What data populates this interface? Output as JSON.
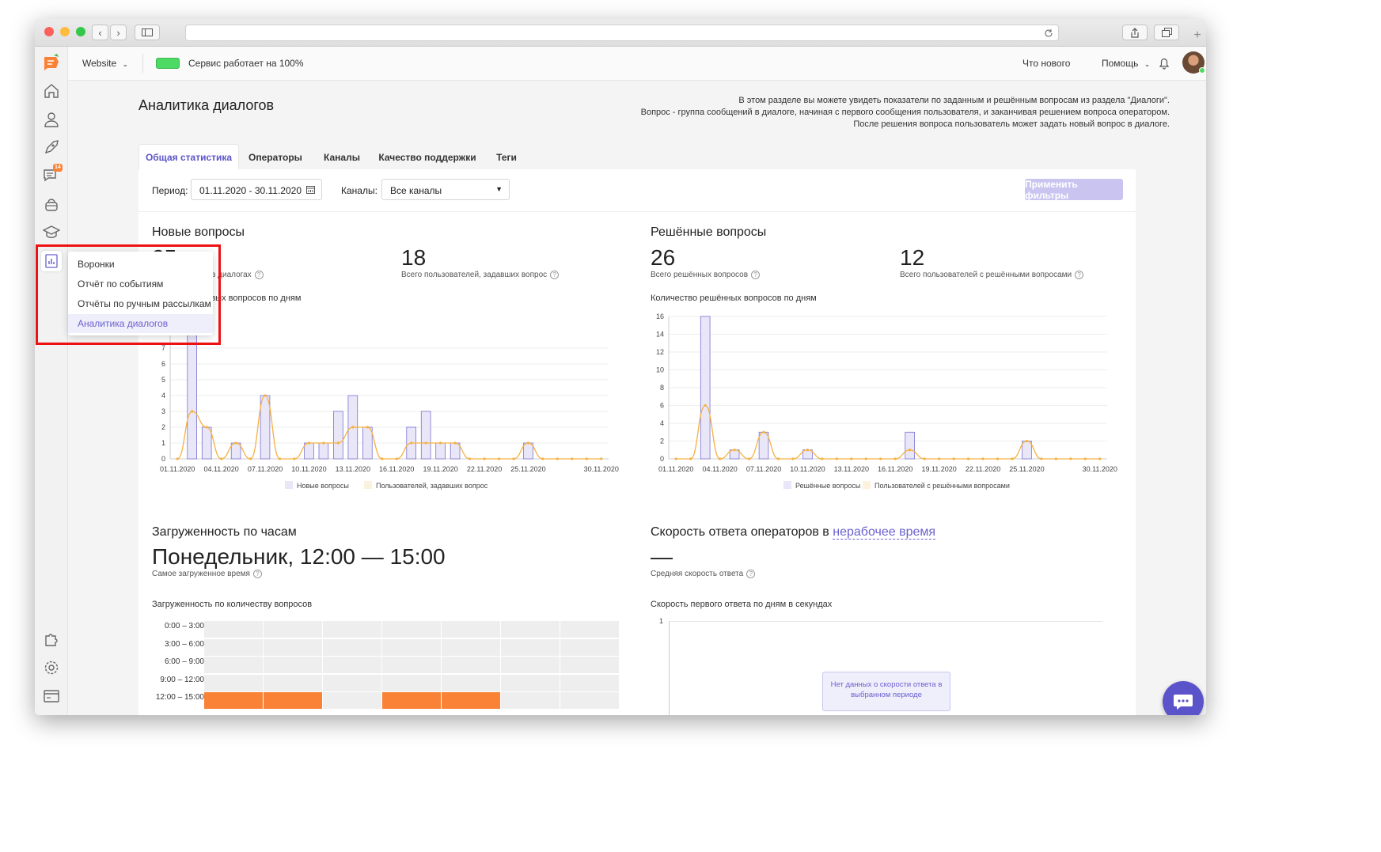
{
  "topbar": {
    "site_label": "Website",
    "status_text": "Сервис работает на 100%",
    "whats_new": "Что нового",
    "help": "Помощь"
  },
  "sidebar": {
    "chat_badge": "14",
    "icons": [
      "home-icon",
      "users-icon",
      "rocket-icon",
      "chats-icon",
      "bot-icon",
      "academy-icon",
      "analytics-icon",
      "puzzle-icon",
      "settings-icon",
      "billing-icon"
    ]
  },
  "popup_menu": {
    "items": [
      "Воронки",
      "Отчёт по событиям",
      "Отчёты по ручным рассылкам",
      "Аналитика диалогов"
    ],
    "active_index": 3
  },
  "page": {
    "title": "Аналитика диалогов",
    "description_1": "В этом разделе вы можете увидеть показатели по заданным и решённым вопросам из раздела \"Диалоги\".",
    "description_2": "Вопрос - группа сообщений в диалоге, начиная с первого сообщения пользователя, и заканчивая решением вопроса оператором.",
    "description_3": "После решения вопроса пользователь может задать новый вопрос в диалоге."
  },
  "tabs": [
    "Общая статистика",
    "Операторы",
    "Каналы",
    "Качество поддержки",
    "Теги"
  ],
  "filters": {
    "period_label": "Период:",
    "period_value": "01.11.2020 - 30.11.2020",
    "channels_label": "Каналы:",
    "channels_value": "Все каналы",
    "apply_button": "Применить фильтры"
  },
  "new_questions": {
    "title": "Новые вопросы",
    "total_value": "25",
    "total_label": "Всего вопросов в диалогах",
    "users_value": "18",
    "users_label": "Всего пользователей, задавших вопрос",
    "chart_title": "Количество новых вопросов по дням"
  },
  "resolved_questions": {
    "title": "Решённые вопросы",
    "total_value": "26",
    "total_label": "Всего решённых вопросов",
    "users_value": "12",
    "users_label": "Всего пользователей с решёнными вопросами",
    "chart_title": "Количество решённых вопросов по дням"
  },
  "load": {
    "title": "Загруженность по часам",
    "busiest": "Понедельник, 12:00 — 15:00",
    "busiest_label": "Самое загруженное время",
    "heatmap_title": "Загруженность по количеству вопросов",
    "rows": [
      "0:00 – 3:00",
      "3:00 – 6:00",
      "6:00 – 9:00",
      "9:00 – 12:00",
      "12:00 – 15:00"
    ]
  },
  "speed": {
    "title_prefix": "Скорость ответа операторов в",
    "title_link": "нерабочее время",
    "value": "—",
    "value_label": "Средняя скорость ответа",
    "chart_title": "Скорость первого ответа по дням в секундах",
    "y_tick": "1",
    "no_data": "Нет данных о скорости ответа в выбранном периоде"
  },
  "chart_data": [
    {
      "type": "bar",
      "title": "Количество новых вопросов по дням",
      "x": [
        "01.11.2020",
        "02.11.2020",
        "03.11.2020",
        "04.11.2020",
        "05.11.2020",
        "06.11.2020",
        "07.11.2020",
        "08.11.2020",
        "09.11.2020",
        "10.11.2020",
        "11.11.2020",
        "12.11.2020",
        "13.11.2020",
        "14.11.2020",
        "15.11.2020",
        "16.11.2020",
        "17.11.2020",
        "18.11.2020",
        "19.11.2020",
        "20.11.2020",
        "21.11.2020",
        "22.11.2020",
        "23.11.2020",
        "24.11.2020",
        "25.11.2020",
        "26.11.2020",
        "27.11.2020",
        "28.11.2020",
        "29.11.2020",
        "30.11.2020"
      ],
      "x_tick_labels": [
        "01.11.2020",
        "04.11.2020",
        "07.11.2020",
        "10.11.2020",
        "13.11.2020",
        "16.11.2020",
        "19.11.2020",
        "22.11.2020",
        "25.11.2020",
        "30.11.2020"
      ],
      "series": [
        {
          "name": "Новые вопросы",
          "kind": "bar",
          "color": "#e8e6f7",
          "values": [
            0,
            9,
            2,
            0,
            1,
            0,
            4,
            0,
            0,
            1,
            1,
            3,
            4,
            2,
            0,
            0,
            2,
            3,
            1,
            1,
            0,
            0,
            0,
            0,
            1,
            0,
            0,
            0,
            0,
            0
          ]
        },
        {
          "name": "Пользователей, задавших вопрос",
          "kind": "line",
          "color": "#f5b041",
          "values": [
            0,
            3,
            2,
            0,
            1,
            0,
            4,
            0,
            0,
            1,
            1,
            1,
            2,
            2,
            0,
            0,
            1,
            1,
            1,
            1,
            0,
            0,
            0,
            0,
            1,
            0,
            0,
            0,
            0,
            0
          ]
        }
      ],
      "ylim": [
        0,
        9
      ],
      "y_ticks": [
        0,
        1,
        2,
        3,
        4,
        5,
        6,
        7
      ]
    },
    {
      "type": "bar",
      "title": "Количество решённых вопросов по дням",
      "x": [
        "01.11.2020",
        "02.11.2020",
        "03.11.2020",
        "04.11.2020",
        "05.11.2020",
        "06.11.2020",
        "07.11.2020",
        "08.11.2020",
        "09.11.2020",
        "10.11.2020",
        "11.11.2020",
        "12.11.2020",
        "13.11.2020",
        "14.11.2020",
        "15.11.2020",
        "16.11.2020",
        "17.11.2020",
        "18.11.2020",
        "19.11.2020",
        "20.11.2020",
        "21.11.2020",
        "22.11.2020",
        "23.11.2020",
        "24.11.2020",
        "25.11.2020",
        "26.11.2020",
        "27.11.2020",
        "28.11.2020",
        "29.11.2020",
        "30.11.2020"
      ],
      "x_tick_labels": [
        "01.11.2020",
        "04.11.2020",
        "07.11.2020",
        "10.11.2020",
        "13.11.2020",
        "16.11.2020",
        "19.11.2020",
        "22.11.2020",
        "25.11.2020",
        "30.11.2020"
      ],
      "series": [
        {
          "name": "Решённые вопросы",
          "kind": "bar",
          "color": "#e8e6f7",
          "values": [
            0,
            0,
            16,
            0,
            1,
            0,
            3,
            0,
            0,
            1,
            0,
            0,
            0,
            0,
            0,
            0,
            3,
            0,
            0,
            0,
            0,
            0,
            0,
            0,
            2,
            0,
            0,
            0,
            0,
            0
          ]
        },
        {
          "name": "Пользователей с решёнными вопросами",
          "kind": "line",
          "color": "#f5b041",
          "values": [
            0,
            0,
            6,
            0,
            1,
            0,
            3,
            0,
            0,
            1,
            0,
            0,
            0,
            0,
            0,
            0,
            1,
            0,
            0,
            0,
            0,
            0,
            0,
            0,
            2,
            0,
            0,
            0,
            0,
            0
          ]
        }
      ],
      "ylim": [
        0,
        16
      ],
      "y_ticks": [
        0,
        2,
        4,
        6,
        8,
        10,
        12,
        14,
        16
      ]
    }
  ],
  "heatmap": {
    "cols": 7,
    "highlight_row": 4,
    "highlight_cols": [
      0,
      1,
      3,
      4
    ],
    "highlight_color": "#f98237",
    "base_color": "#eeeeee"
  },
  "colors": {
    "accent": "#5b53c9",
    "brand_orange": "#f98237",
    "status_green": "#4cd964",
    "apply_button_bg": "#c9c5f0",
    "popup_active_bg": "#efeefb"
  }
}
